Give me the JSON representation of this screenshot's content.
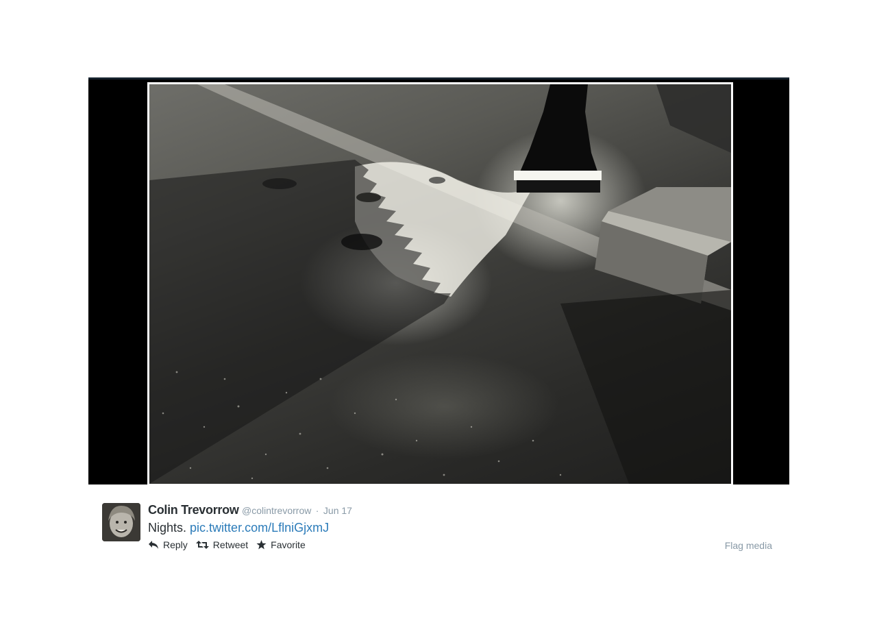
{
  "media": {
    "alt": "Black and white night photo of wet pavement with a palm tree shadow, a lamp post base and a concrete bench"
  },
  "tweet": {
    "fullname": "Colin Trevorrow",
    "username": "@colintrevorrow",
    "separator": "·",
    "timestamp": "Jun 17",
    "text": "Nights.",
    "link": "pic.twitter.com/LflniGjxmJ"
  },
  "actions": {
    "reply": "Reply",
    "retweet": "Retweet",
    "favorite": "Favorite",
    "flag_media": "Flag media"
  },
  "colors": {
    "name": "#292f33",
    "meta": "#8899a6",
    "link": "#2b7bb9",
    "stage": "#000000"
  },
  "icons": {
    "reply": "reply-icon",
    "retweet": "retweet-icon",
    "favorite": "star-icon"
  }
}
